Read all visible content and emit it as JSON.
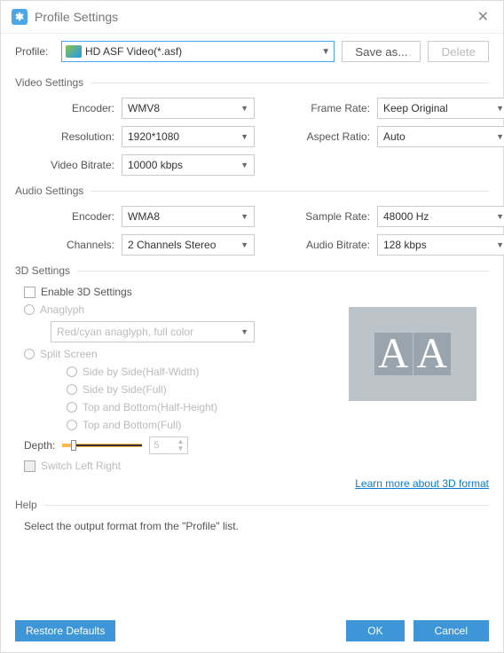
{
  "header": {
    "title": "Profile Settings"
  },
  "profile": {
    "label": "Profile:",
    "value": "HD ASF Video(*.asf)",
    "save_as": "Save as...",
    "delete": "Delete"
  },
  "video": {
    "title": "Video Settings",
    "encoder_label": "Encoder:",
    "encoder": "WMV8",
    "resolution_label": "Resolution:",
    "resolution": "1920*1080",
    "bitrate_label": "Video Bitrate:",
    "bitrate": "10000 kbps",
    "framerate_label": "Frame Rate:",
    "framerate": "Keep Original",
    "aspect_label": "Aspect Ratio:",
    "aspect": "Auto"
  },
  "audio": {
    "title": "Audio Settings",
    "encoder_label": "Encoder:",
    "encoder": "WMA8",
    "channels_label": "Channels:",
    "channels": "2 Channels Stereo",
    "samplerate_label": "Sample Rate:",
    "samplerate": "48000 Hz",
    "bitrate_label": "Audio Bitrate:",
    "bitrate": "128 kbps"
  },
  "three_d": {
    "title": "3D Settings",
    "enable_label": "Enable 3D Settings",
    "anaglyph_label": "Anaglyph",
    "anaglyph_value": "Red/cyan anaglyph, full color",
    "split_label": "Split Screen",
    "opts": {
      "sbs_half": "Side by Side(Half-Width)",
      "sbs_full": "Side by Side(Full)",
      "tb_half": "Top and Bottom(Half-Height)",
      "tb_full": "Top and Bottom(Full)"
    },
    "depth_label": "Depth:",
    "depth_value": "5",
    "switch_label": "Switch Left Right",
    "learn_more": "Learn more about 3D format"
  },
  "help": {
    "title": "Help",
    "text": "Select the output format from the \"Profile\" list."
  },
  "footer": {
    "restore": "Restore Defaults",
    "ok": "OK",
    "cancel": "Cancel"
  }
}
